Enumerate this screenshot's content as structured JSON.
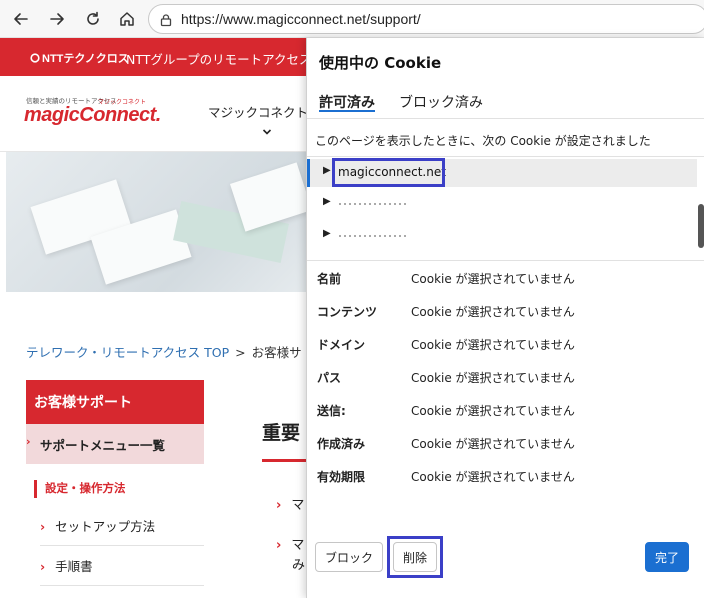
{
  "browser": {
    "url": "https://www.magicconnect.net/support/"
  },
  "site": {
    "topbar_logo": "NTTテクノクロス",
    "topbar_text": "NTTグループのリモートアクセス",
    "tagline": "信頼と実績のリモートアクセス",
    "brand": "magicConnect.",
    "brand_kana": "マジックコネクト",
    "header_nav": "マジックコネクト",
    "breadcrumb_home": "テレワーク・リモートアクセス TOP",
    "breadcrumb_sep": ">",
    "breadcrumb_current": "お客様サ",
    "sidebar_title": "お客様サポート",
    "sidebar_active": "サポートメニュー一覧",
    "section_label": "設定・操作方法",
    "sidebar_links": [
      "セットアップ方法",
      "手順書"
    ],
    "main_heading": "重要",
    "main_items": [
      "マ",
      "マ",
      "み"
    ]
  },
  "dialog": {
    "title": "使用中の Cookie",
    "tabs": [
      "許可済み",
      "ブロック済み"
    ],
    "description": "このページを表示したときに、次の Cookie が設定されました",
    "tree": [
      {
        "label": "magicconnect.net",
        "selected": true
      },
      {
        "label": "",
        "selected": false
      },
      {
        "label": "",
        "selected": false
      }
    ],
    "properties": [
      {
        "label": "名前",
        "value": "Cookie が選択されていません"
      },
      {
        "label": "コンテンツ",
        "value": "Cookie が選択されていません"
      },
      {
        "label": "ドメイン",
        "value": "Cookie が選択されていません"
      },
      {
        "label": "パス",
        "value": "Cookie が選択されていません"
      },
      {
        "label": "送信:",
        "value": "Cookie が選択されていません"
      },
      {
        "label": "作成済み",
        "value": "Cookie が選択されていません"
      },
      {
        "label": "有効期限",
        "value": "Cookie が選択されていません"
      }
    ],
    "buttons": {
      "block": "ブロック",
      "delete": "削除",
      "done": "完了"
    }
  },
  "colors": {
    "brand_red": "#d7282f",
    "accent_blue": "#1b6fd1",
    "highlight": "#3b3fc7"
  }
}
